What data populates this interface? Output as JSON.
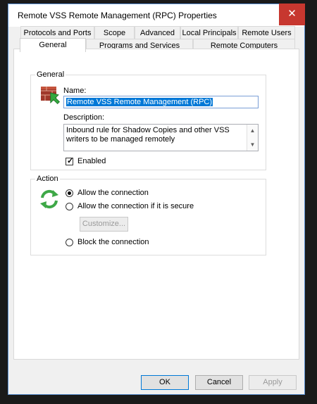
{
  "window": {
    "title": "Remote VSS Remote Management (RPC) Properties",
    "close_glyph": "✕"
  },
  "tabs": {
    "row1": [
      "Protocols and Ports",
      "Scope",
      "Advanced",
      "Local Principals",
      "Remote Users"
    ],
    "row2": [
      "General",
      "Programs and Services",
      "Remote Computers"
    ],
    "active": "General"
  },
  "general_group": {
    "label": "General",
    "name_label": "Name:",
    "name_value": "Remote VSS Remote Management (RPC)",
    "description_label": "Description:",
    "description_value": "Inbound rule for Shadow Copies and other VSS writers to be managed remotely",
    "enabled_label": "Enabled",
    "enabled": true,
    "icon": "firewall-rule-icon"
  },
  "action_group": {
    "label": "Action",
    "icon": "refresh-arrows-icon",
    "options": [
      "Allow the connection",
      "Allow the connection if it is secure",
      "Block the connection"
    ],
    "selected": "Allow the connection",
    "customize_label": "Customize..."
  },
  "footer": {
    "ok_label": "OK",
    "cancel_label": "Cancel",
    "apply_label": "Apply"
  },
  "colors": {
    "close_button": "#c7372f",
    "selection": "#0078d7",
    "window_border": "#5a8fd0"
  }
}
